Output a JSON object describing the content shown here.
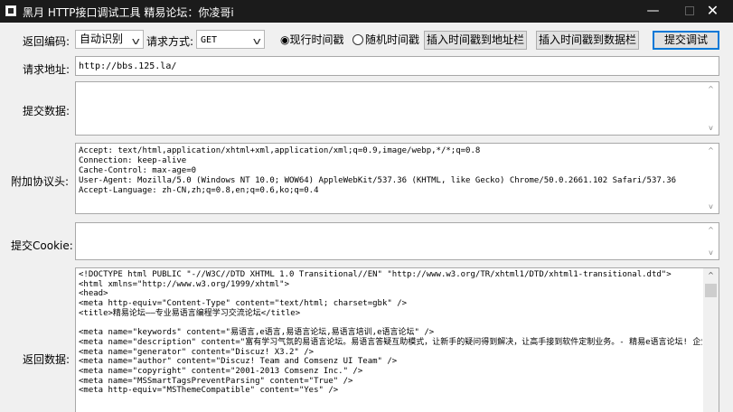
{
  "window": {
    "title": "黑月 HTTP接口调试工具    精易论坛：你凌哥i",
    "min_glyph": "—",
    "close_glyph": "✕"
  },
  "toolbar": {
    "encoding_label": "返回编码:",
    "encoding_value": "自动识别",
    "method_label": "请求方式:",
    "method_value": "GET",
    "radio_current_time": "◉现行时间戳",
    "radio_random_time": "随机时间戳",
    "insert_url_button": "插入时间戳到地址栏",
    "insert_data_button": "插入时间戳到数据栏",
    "submit_button": "提交调试"
  },
  "form": {
    "url_label": "请求地址:",
    "url_value": "http://bbs.125.la/",
    "postdata_label": "提交数据:",
    "postdata_value": "",
    "headers_label": "附加协议头:",
    "headers_value": "Accept: text/html,application/xhtml+xml,application/xml;q=0.9,image/webp,*/*;q=0.8\nConnection: keep-alive\nCache-Control: max-age=0\nUser-Agent: Mozilla/5.0 (Windows NT 10.0; WOW64) AppleWebKit/537.36 (KHTML, like Gecko) Chrome/50.0.2661.102 Safari/537.36\nAccept-Language: zh-CN,zh;q=0.8,en;q=0.6,ko;q=0.4",
    "cookie_label": "提交Cookie:",
    "cookie_value": "",
    "response_label": "返回数据:",
    "response_value": "<!DOCTYPE html PUBLIC \"-//W3C//DTD XHTML 1.0 Transitional//EN\" \"http://www.w3.org/TR/xhtml1/DTD/xhtml1-transitional.dtd\">\n<html xmlns=\"http://www.w3.org/1999/xhtml\">\n<head>\n<meta http-equiv=\"Content-Type\" content=\"text/html; charset=gbk\" />\n<title>精易论坛——专业易语言编程学习交流论坛</title>\n\n<meta name=\"keywords\" content=\"易语言,e语言,易语言论坛,易语言培训,e语言论坛\" />\n<meta name=\"description\" content=\"富有学习气氛的易语言论坛。易语言答疑互助模式，让新手的疑问得到解决，让高手接到软件定制业务。- 精易e语言论坛! 企业Q800073686 \" />\n<meta name=\"generator\" content=\"Discuz! X3.2\" />\n<meta name=\"author\" content=\"Discuz! Team and Comsenz UI Team\" />\n<meta name=\"copyright\" content=\"2001-2013 Comsenz Inc.\" />\n<meta name=\"MSSmartTagsPreventParsing\" content=\"True\" />\n<meta http-equiv=\"MSThemeCompatible\" content=\"Yes\" />"
  },
  "colors": {
    "titlebar_bg": "#1b1b1b",
    "window_bg": "#f0f0f0",
    "primary_border": "#0078d7"
  }
}
